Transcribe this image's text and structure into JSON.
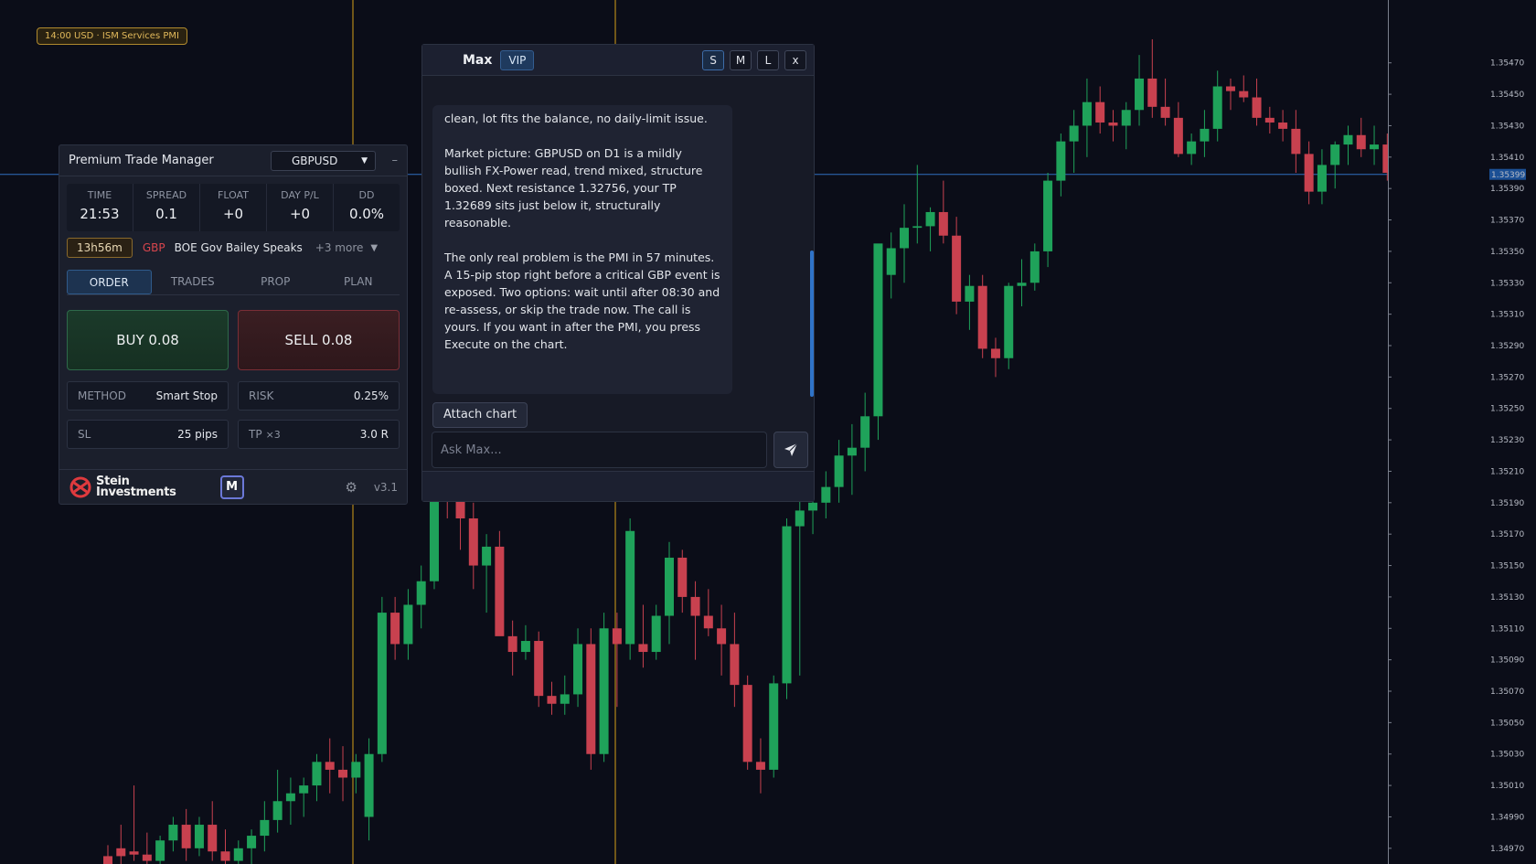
{
  "event_badge": "14:00 USD · ISM Services PMI",
  "price_axis": {
    "labels": [
      "1.35470",
      "1.35450",
      "1.35430",
      "1.35410",
      "1.35390",
      "1.35370",
      "1.35350",
      "1.35330",
      "1.35310",
      "1.35290",
      "1.35270",
      "1.35250",
      "1.35230",
      "1.35210",
      "1.35190",
      "1.35170",
      "1.35150",
      "1.35130",
      "1.35110",
      "1.35090",
      "1.35070",
      "1.35050",
      "1.35030",
      "1.35010",
      "1.34990",
      "1.34970"
    ],
    "current_price": "1.35399"
  },
  "chart_data": {
    "type": "candlestick",
    "symbol": "GBPUSD",
    "ylim": [
      1.3496,
      1.3551
    ],
    "candles": [
      [
        1.34965,
        1.34972,
        1.3494,
        1.3496
      ],
      [
        1.3497,
        1.34985,
        1.34955,
        1.34965
      ],
      [
        1.34968,
        1.3501,
        1.34962,
        1.34966
      ],
      [
        1.34966,
        1.3498,
        1.34958,
        1.34962
      ],
      [
        1.34962,
        1.34978,
        1.34955,
        1.34975
      ],
      [
        1.34975,
        1.3499,
        1.34968,
        1.34985
      ],
      [
        1.34985,
        1.34995,
        1.34962,
        1.3497
      ],
      [
        1.3497,
        1.3499,
        1.34965,
        1.34985
      ],
      [
        1.34985,
        1.35,
        1.34962,
        1.34968
      ],
      [
        1.34968,
        1.34982,
        1.34958,
        1.34962
      ],
      [
        1.34962,
        1.34975,
        1.3495,
        1.3497
      ],
      [
        1.3497,
        1.34982,
        1.3496,
        1.34978
      ],
      [
        1.34978,
        1.35,
        1.34968,
        1.34988
      ],
      [
        1.34988,
        1.3502,
        1.3498,
        1.35
      ],
      [
        1.35,
        1.35015,
        1.34985,
        1.35005
      ],
      [
        1.35005,
        1.35015,
        1.3499,
        1.3501
      ],
      [
        1.3501,
        1.3503,
        1.35,
        1.35025
      ],
      [
        1.35025,
        1.3504,
        1.35005,
        1.3502
      ],
      [
        1.3502,
        1.35035,
        1.35,
        1.35015
      ],
      [
        1.35015,
        1.3503,
        1.35005,
        1.35025
      ],
      [
        1.3499,
        1.3504,
        1.34975,
        1.3503
      ],
      [
        1.3503,
        1.3513,
        1.35025,
        1.3512
      ],
      [
        1.3512,
        1.3513,
        1.3509,
        1.351
      ],
      [
        1.351,
        1.35135,
        1.3509,
        1.35125
      ],
      [
        1.35125,
        1.3515,
        1.3511,
        1.3514
      ],
      [
        1.3514,
        1.3522,
        1.35135,
        1.35208
      ],
      [
        1.35208,
        1.35225,
        1.3518,
        1.35195
      ],
      [
        1.35195,
        1.352,
        1.3516,
        1.3518
      ],
      [
        1.3518,
        1.3519,
        1.35135,
        1.3515
      ],
      [
        1.3515,
        1.3517,
        1.3512,
        1.35162
      ],
      [
        1.35162,
        1.35172,
        1.3512,
        1.35105
      ],
      [
        1.35105,
        1.35115,
        1.3508,
        1.35095
      ],
      [
        1.35095,
        1.35112,
        1.3509,
        1.35102
      ],
      [
        1.35102,
        1.35108,
        1.3506,
        1.35067
      ],
      [
        1.35067,
        1.35076,
        1.35055,
        1.35062
      ],
      [
        1.35062,
        1.3508,
        1.35055,
        1.35068
      ],
      [
        1.35068,
        1.3511,
        1.3506,
        1.351
      ],
      [
        1.351,
        1.3511,
        1.3502,
        1.3503
      ],
      [
        1.3503,
        1.3512,
        1.35025,
        1.3511
      ],
      [
        1.3511,
        1.3512,
        1.3506,
        1.351
      ],
      [
        1.351,
        1.3518,
        1.3509,
        1.35172
      ],
      [
        1.351,
        1.35125,
        1.35085,
        1.35095
      ],
      [
        1.35095,
        1.35125,
        1.3509,
        1.35118
      ],
      [
        1.35118,
        1.35165,
        1.351,
        1.35155
      ],
      [
        1.35155,
        1.3516,
        1.3512,
        1.3513
      ],
      [
        1.3513,
        1.3514,
        1.3509,
        1.35118
      ],
      [
        1.35118,
        1.35135,
        1.35105,
        1.3511
      ],
      [
        1.3511,
        1.35125,
        1.3508,
        1.351
      ],
      [
        1.351,
        1.3512,
        1.3506,
        1.35074
      ],
      [
        1.35074,
        1.3508,
        1.3502,
        1.35025
      ],
      [
        1.35025,
        1.3504,
        1.35005,
        1.3502
      ],
      [
        1.3502,
        1.3508,
        1.35015,
        1.35075
      ],
      [
        1.35075,
        1.3518,
        1.35065,
        1.35175
      ],
      [
        1.35175,
        1.35195,
        1.3508,
        1.35185
      ],
      [
        1.35185,
        1.352,
        1.3517,
        1.3519
      ],
      [
        1.3519,
        1.3521,
        1.3518,
        1.352
      ],
      [
        1.352,
        1.3523,
        1.3519,
        1.3522
      ],
      [
        1.3522,
        1.3524,
        1.35195,
        1.35225
      ],
      [
        1.35225,
        1.3526,
        1.3521,
        1.35245
      ],
      [
        1.35245,
        1.3528,
        1.3523,
        1.35355
      ],
      [
        1.35335,
        1.35362,
        1.3532,
        1.35352
      ],
      [
        1.35352,
        1.3538,
        1.3533,
        1.35365
      ],
      [
        1.35365,
        1.35405,
        1.35355,
        1.35366
      ],
      [
        1.35366,
        1.35378,
        1.3535,
        1.35375
      ],
      [
        1.35375,
        1.35395,
        1.35355,
        1.3536
      ],
      [
        1.3536,
        1.35372,
        1.3531,
        1.35318
      ],
      [
        1.35318,
        1.35335,
        1.353,
        1.35328
      ],
      [
        1.35328,
        1.35335,
        1.35282,
        1.35288
      ],
      [
        1.35288,
        1.35295,
        1.3527,
        1.35282
      ],
      [
        1.35282,
        1.3533,
        1.35275,
        1.35328
      ],
      [
        1.35328,
        1.35345,
        1.35315,
        1.3533
      ],
      [
        1.3533,
        1.35355,
        1.35325,
        1.3535
      ],
      [
        1.3535,
        1.354,
        1.3534,
        1.35395
      ],
      [
        1.35395,
        1.35425,
        1.35385,
        1.3542
      ],
      [
        1.3542,
        1.3544,
        1.354,
        1.3543
      ],
      [
        1.3543,
        1.3546,
        1.3541,
        1.35445
      ],
      [
        1.35445,
        1.35455,
        1.35425,
        1.35432
      ],
      [
        1.35432,
        1.3544,
        1.3542,
        1.3543
      ],
      [
        1.3543,
        1.35445,
        1.35415,
        1.3544
      ],
      [
        1.3544,
        1.35475,
        1.3543,
        1.3546
      ],
      [
        1.3546,
        1.35485,
        1.35435,
        1.35442
      ],
      [
        1.35442,
        1.3546,
        1.3543,
        1.35435
      ],
      [
        1.35435,
        1.35445,
        1.3541,
        1.35412
      ],
      [
        1.35412,
        1.35425,
        1.35405,
        1.3542
      ],
      [
        1.3542,
        1.3544,
        1.3541,
        1.35428
      ],
      [
        1.35428,
        1.35465,
        1.3542,
        1.35455
      ],
      [
        1.35455,
        1.3546,
        1.3544,
        1.35452
      ],
      [
        1.35452,
        1.35462,
        1.35445,
        1.35448
      ],
      [
        1.35448,
        1.3546,
        1.3543,
        1.35435
      ],
      [
        1.35435,
        1.35442,
        1.35425,
        1.35432
      ],
      [
        1.35432,
        1.3544,
        1.3542,
        1.35428
      ],
      [
        1.35428,
        1.3544,
        1.354,
        1.35412
      ],
      [
        1.35412,
        1.3542,
        1.3538,
        1.35388
      ],
      [
        1.35388,
        1.35415,
        1.3538,
        1.35405
      ],
      [
        1.35405,
        1.3542,
        1.3539,
        1.35418
      ],
      [
        1.35418,
        1.3543,
        1.35405,
        1.35424
      ],
      [
        1.35424,
        1.35435,
        1.3541,
        1.35415
      ],
      [
        1.35415,
        1.3543,
        1.35405,
        1.35418
      ],
      [
        1.35418,
        1.35425,
        1.35395,
        1.354
      ],
      [
        1.354,
        1.3541,
        1.3538,
        1.35385
      ],
      [
        1.35385,
        1.35392,
        1.35378,
        1.35384
      ],
      [
        1.35384,
        1.35392,
        1.35378,
        1.35385
      ],
      [
        1.35385,
        1.35395,
        1.35375,
        1.35386
      ],
      [
        1.35386,
        1.35402,
        1.3538,
        1.35398
      ]
    ],
    "vertical_markers": 2,
    "horizontal_level": 1.35399
  },
  "ptm": {
    "title": "Premium Trade Manager",
    "symbol": "GBPUSD",
    "minimize": "–",
    "stats": [
      {
        "label": "TIME",
        "value": "21:53"
      },
      {
        "label": "SPREAD",
        "value": "0.1"
      },
      {
        "label": "FLOAT",
        "value": "+0"
      },
      {
        "label": "DAY P/L",
        "value": "+0"
      },
      {
        "label": "DD",
        "value": "0.0%"
      }
    ],
    "news": {
      "timer": "13h56m",
      "currency": "GBP",
      "title": "BOE Gov Bailey Speaks",
      "more": "+3 more"
    },
    "tabs": [
      "ORDER",
      "TRADES",
      "PROP",
      "PLAN"
    ],
    "buy_label": "BUY 0.08",
    "sell_label": "SELL 0.08",
    "method": {
      "key": "METHOD",
      "value": "Smart Stop"
    },
    "risk": {
      "key": "RISK",
      "value": "0.25%"
    },
    "sl": {
      "key": "SL",
      "value": "25 pips"
    },
    "tp": {
      "key": "TP",
      "mult": "×3",
      "value": "3.0 R"
    },
    "brand_line1": "Stein",
    "brand_line2": "Investments",
    "m_button": "M",
    "version": "v3.1"
  },
  "max": {
    "name": "Max",
    "badge": "VIP",
    "sizes": [
      "S",
      "M",
      "L",
      "x"
    ],
    "message": [
      "clean, lot fits the balance, no daily-limit issue.",
      "Market picture: GBPUSD on D1 is a mildly bullish FX-Power read, trend mixed, structure boxed. Next resistance 1.32756, your TP 1.32689 sits just below it, structurally reasonable.",
      "The only real problem is the PMI in 57 minutes. A 15-pip stop right before a critical GBP event is exposed. Two options: wait until after 08:30 and re-assess, or skip the trade now. The call is yours. If you want in after the PMI, you press Execute on the chart."
    ],
    "attach_label": "Attach chart",
    "input_placeholder": "Ask Max..."
  },
  "colors": {
    "bull": "#1fa25a",
    "bear": "#c8414f",
    "background": "#0b0d18",
    "marker": "#d4a017",
    "level": "#2f6fc0"
  }
}
